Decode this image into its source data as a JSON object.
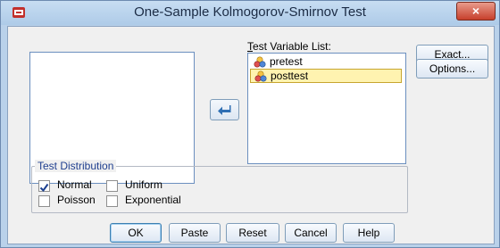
{
  "window": {
    "title": "One-Sample Kolmogorov-Smirnov Test",
    "close_glyph": "×"
  },
  "source_list": {
    "items": []
  },
  "test_variable_list": {
    "label": "Test Variable List:",
    "items": [
      {
        "name": "pretest",
        "selected": false,
        "icon": "scale-variable-icon"
      },
      {
        "name": "posttest",
        "selected": true,
        "icon": "scale-variable-icon"
      }
    ]
  },
  "side_buttons": {
    "exact": "Exact...",
    "options": "Options..."
  },
  "test_distribution": {
    "legend": "Test Distribution",
    "normal": {
      "label": "Normal",
      "checked": true
    },
    "uniform": {
      "label": "Uniform",
      "checked": false
    },
    "poisson": {
      "label": "Poisson",
      "checked": false
    },
    "exponential": {
      "label": "Exponential",
      "checked": false
    }
  },
  "buttons": {
    "ok": "OK",
    "paste": "Paste",
    "reset": "Reset",
    "cancel": "Cancel",
    "help": "Help"
  },
  "colors": {
    "titlebar": "#b9d1ea",
    "selected_row": "#fff3b0",
    "group_legend": "#1f3f8f"
  }
}
